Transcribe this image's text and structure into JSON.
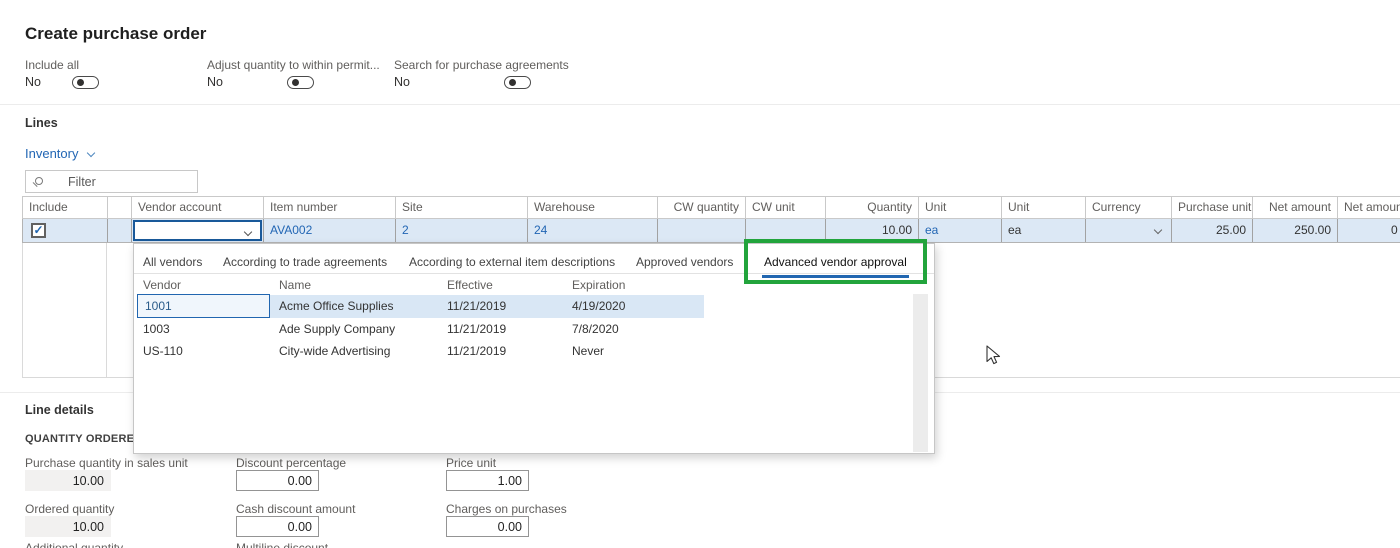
{
  "title": "Create purchase order",
  "colors": {
    "accent_blue": "#2266b4",
    "row_highlight": "#dce8f5",
    "annotation_green": "#22a43c"
  },
  "toggles": [
    {
      "label": "Include all",
      "value": "No"
    },
    {
      "label": "Adjust quantity to within permit...",
      "value": "No"
    },
    {
      "label": "Search for purchase agreements",
      "value": "No"
    }
  ],
  "lines_section": {
    "heading": "Lines",
    "view_selector": "Inventory",
    "filter_placeholder": "Filter"
  },
  "grid": {
    "columns": [
      "Include",
      "",
      "Vendor account",
      "Item number",
      "Site",
      "Warehouse",
      "CW quantity",
      "CW unit",
      "Quantity",
      "Unit",
      "Unit",
      "Currency",
      "Purchase unit...",
      "Net amount",
      "Net amount"
    ],
    "row": {
      "include_checked": "✓",
      "vendor_account": "",
      "item_number": "AVA002",
      "site": "2",
      "warehouse": "24",
      "cw_quantity": "",
      "cw_unit": "",
      "quantity": "10.00",
      "unit_inventory": "ea",
      "unit_purchase": "ea",
      "currency": "",
      "purchase_unit_price": "25.00",
      "net_amount": "250.00",
      "net_amount_2": "0"
    }
  },
  "vendor_popup": {
    "tabs": [
      {
        "label": "All vendors"
      },
      {
        "label": "According to trade agreements"
      },
      {
        "label": "According to external item descriptions"
      },
      {
        "label": "Approved vendors"
      },
      {
        "label": "Advanced vendor approval"
      }
    ],
    "active_tab": "Advanced vendor approval",
    "columns": [
      "Vendor",
      "Name",
      "Effective",
      "Expiration"
    ],
    "rows": [
      {
        "vendor": "1001",
        "name": "Acme Office Supplies",
        "effective": "11/21/2019",
        "expiration": "4/19/2020"
      },
      {
        "vendor": "1003",
        "name": "Ade Supply Company",
        "effective": "11/21/2019",
        "expiration": "7/8/2020"
      },
      {
        "vendor": "US-110",
        "name": "City-wide Advertising",
        "effective": "11/21/2019",
        "expiration": "Never"
      }
    ]
  },
  "line_details": {
    "heading": "Line details",
    "group_heading": "QUANTITY ORDERED IN",
    "fields": [
      {
        "label": "Purchase quantity in sales unit",
        "value": "10.00"
      },
      {
        "label": "Discount percentage",
        "value": "0.00"
      },
      {
        "label": "Price unit",
        "value": "1.00"
      },
      {
        "label": "Ordered quantity",
        "value": "10.00"
      },
      {
        "label": "Cash discount amount",
        "value": "0.00"
      },
      {
        "label": "Charges on purchases",
        "value": "0.00"
      }
    ],
    "clipped_partial_labels": [
      "Additional quantity",
      "Multiline discount"
    ]
  }
}
